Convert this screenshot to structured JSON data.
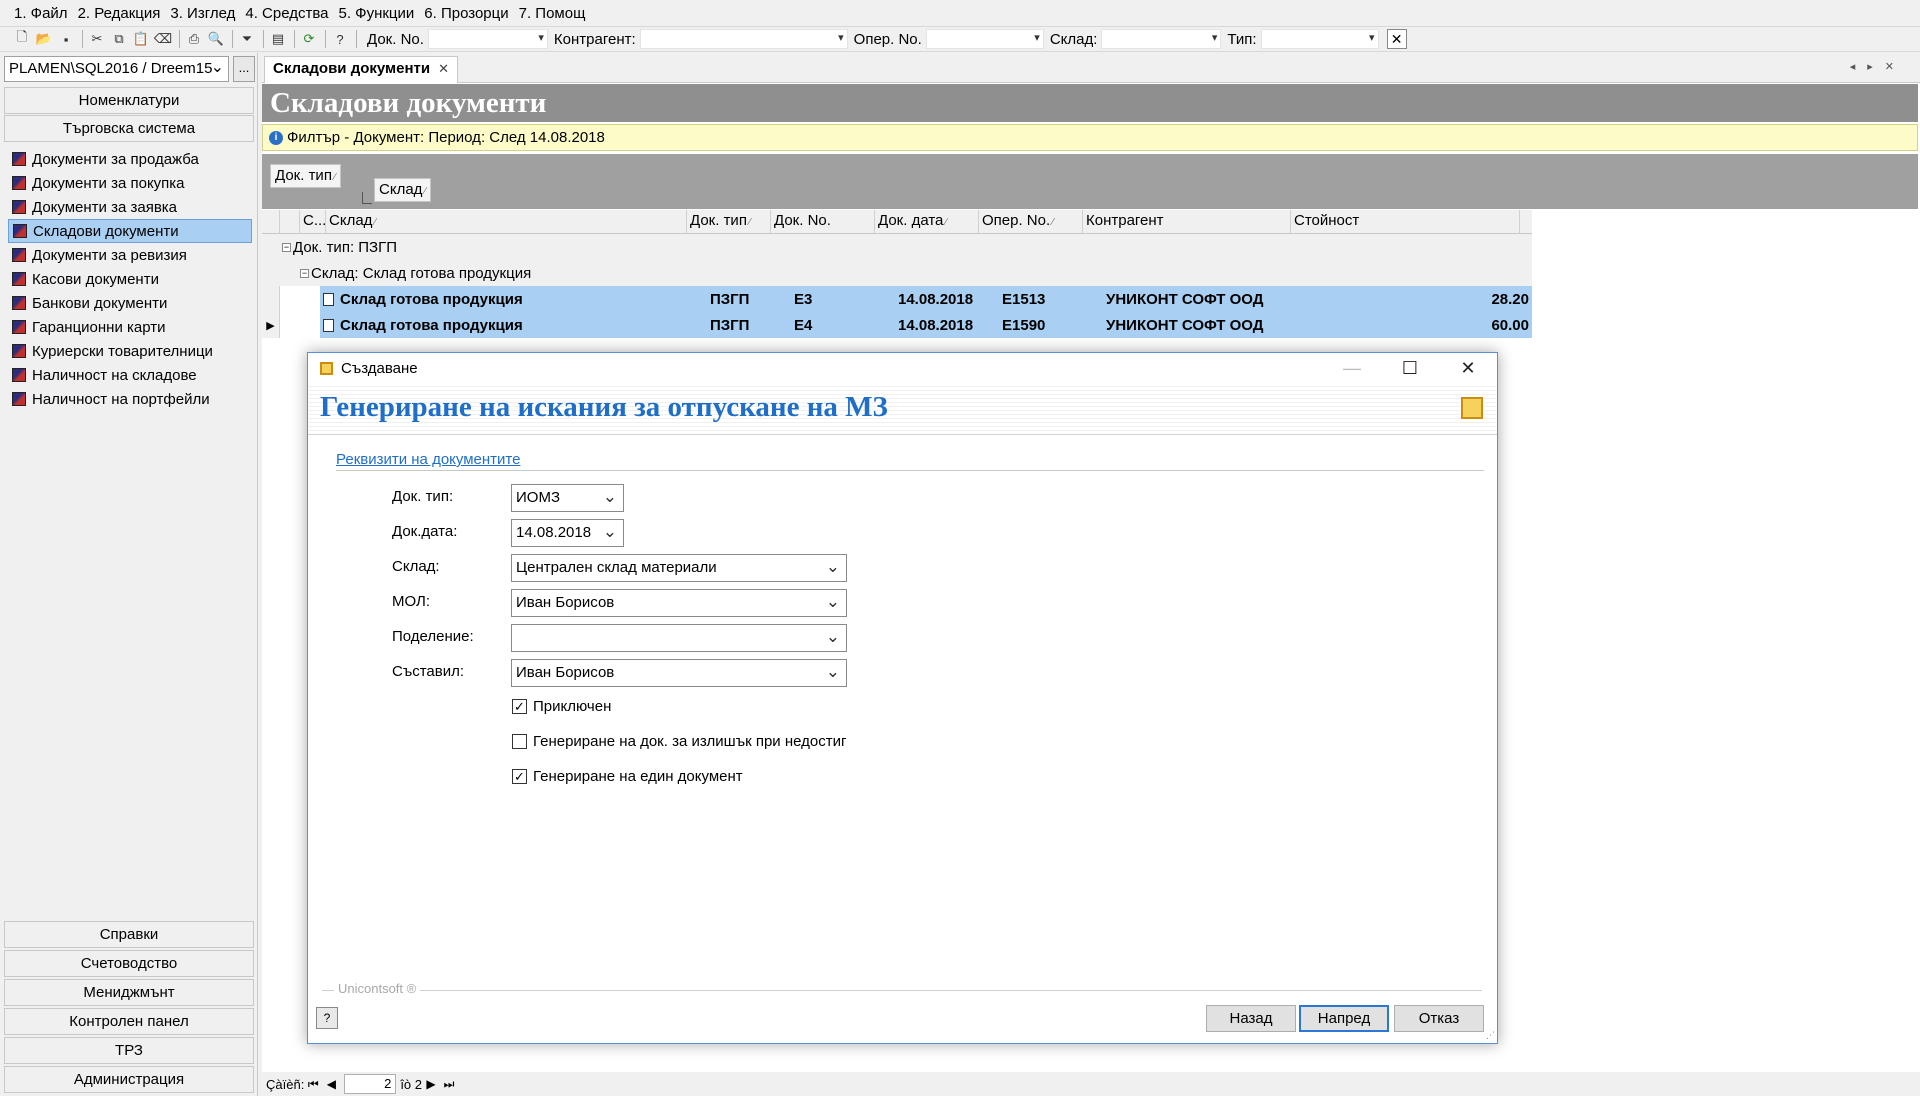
{
  "menu": [
    "1. Файл",
    "2. Редакция",
    "3. Изглед",
    "4. Средства",
    "5. Функции",
    "6. Прозорци",
    "7. Помощ"
  ],
  "toolbar": {
    "filters": [
      {
        "label": "Док. No.",
        "value": ""
      },
      {
        "label": "Контрагент:",
        "value": ""
      },
      {
        "label": "Опер. No.",
        "value": ""
      },
      {
        "label": "Склад:",
        "value": ""
      },
      {
        "label": "Тип:",
        "value": ""
      }
    ]
  },
  "left": {
    "db_selector": "PLAMEN\\SQL2016 / Dreem15",
    "db_browse": "...",
    "top_sections": [
      "Номенклатури",
      "Търговска система"
    ],
    "nav_items": [
      "Документи за продажба",
      "Документи за покупка",
      "Документи за заявка",
      "Складови документи",
      "Документи за ревизия",
      "Касови документи",
      "Банкови документи",
      "Гаранционни карти",
      "Куриерски товарителници",
      "Наличност на складове",
      "Наличност на портфейли"
    ],
    "active_index": 3,
    "bottom_sections": [
      "Справки",
      "Счетоводство",
      "Мениджмънт",
      "Контролен панел",
      "ТРЗ",
      "Администрация"
    ]
  },
  "main": {
    "tab_label": "Складови документи",
    "banner_title": "Складови документи",
    "filter_text": "Филтър - Документ: Период: След 14.08.2018",
    "group_chips": [
      "Док. тип",
      "Склад"
    ],
    "grid": {
      "columns": [
        "С...",
        "Склад",
        "Док. тип",
        "Док. No.",
        "Док. дата",
        "Опер. No.",
        "Контрагент",
        "Стойност"
      ],
      "group1": "Док. тип: ПЗГП",
      "group2": "Склад: Склад готова продукция",
      "rows": [
        {
          "sklad": "Склад готова продукция",
          "type": "ПЗГП",
          "no": "Е3",
          "date": "14.08.2018",
          "oper": "Е1513",
          "partner": "УНИКОНТ СОФТ ООД",
          "value": "28.20"
        },
        {
          "sklad": "Склад готова продукция",
          "type": "ПЗГП",
          "no": "Е4",
          "date": "14.08.2018",
          "oper": "Е1590",
          "partner": "УНИКОНТ СОФТ ООД",
          "value": "60.00"
        }
      ]
    }
  },
  "status": {
    "label": "Çàïèñ:",
    "page": "2",
    "of": "îò 2"
  },
  "dialog": {
    "window_title": "Създаване",
    "heading": "Генериране на искания за отпускане на МЗ",
    "section_link": "Реквизити на документите",
    "fields": {
      "doc_type": {
        "label": "Док. тип:",
        "value": "ИОМЗ"
      },
      "doc_date": {
        "label": "Док.дата:",
        "value": "14.08.2018"
      },
      "warehouse": {
        "label": "Склад:",
        "value": "Централен склад материали"
      },
      "mol": {
        "label": "МОЛ:",
        "value": "Иван Борисов"
      },
      "division": {
        "label": "Поделение:",
        "value": ""
      },
      "author": {
        "label": "Съставил:",
        "value": "Иван Борисов"
      }
    },
    "checkboxes": [
      {
        "label": "Приключен",
        "checked": true
      },
      {
        "label": "Генериране на док. за излишък при недостиг",
        "checked": false
      },
      {
        "label": "Генериране на един документ",
        "checked": true
      }
    ],
    "brand": "Unicontsoft ®",
    "buttons": {
      "back": "Назад",
      "next": "Напред",
      "cancel": "Отказ"
    }
  }
}
